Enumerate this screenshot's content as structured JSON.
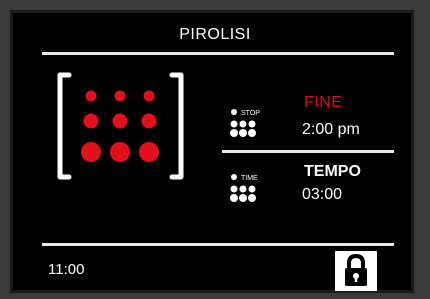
{
  "screen": {
    "title": "PIROLISI",
    "end_row": {
      "icon_label": "STOP",
      "heading": "FINE",
      "value": "2:00 pm"
    },
    "time_row": {
      "icon_label": "TIME",
      "heading": "TEMPO",
      "value": "03:00"
    },
    "footer": {
      "clock": "11:00"
    }
  },
  "colors": {
    "accent_red": "#d4101a",
    "background": "#000000",
    "text": "#ffffff"
  },
  "icons": {
    "main": "oven-burner-grid-icon",
    "end": "stop-dots-icon",
    "time": "time-dots-icon",
    "lock": "padlock-icon"
  }
}
